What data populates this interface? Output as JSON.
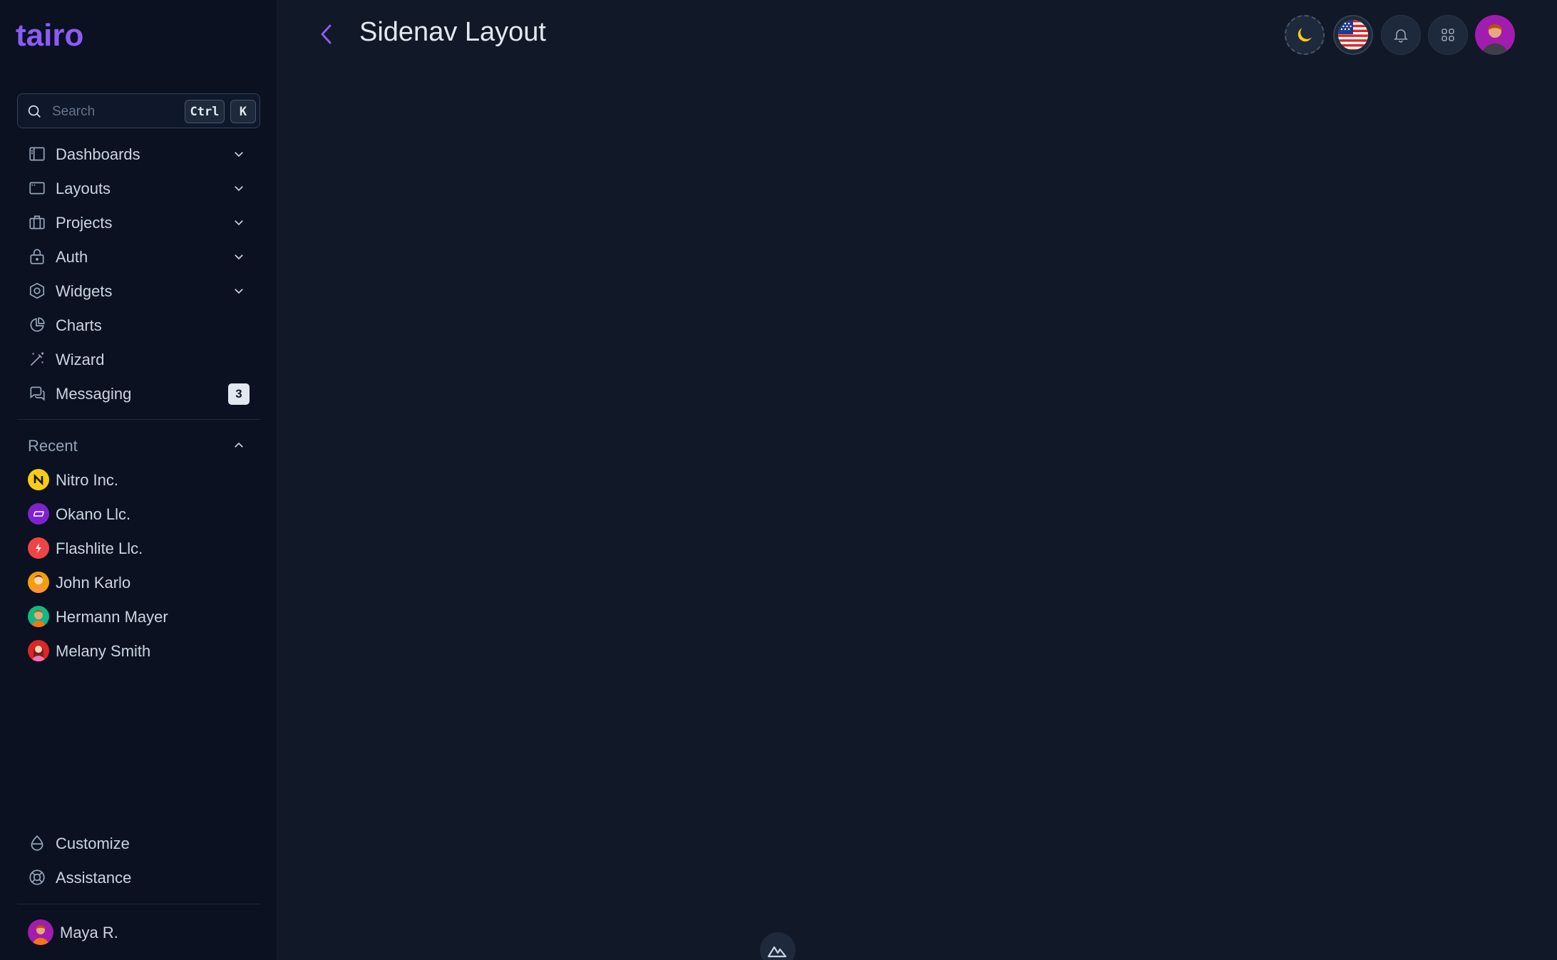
{
  "app": {
    "logo_text": "tairo"
  },
  "search": {
    "placeholder": "Search",
    "shortcut_ctrl": "Ctrl",
    "shortcut_key": "K"
  },
  "nav": {
    "items": [
      {
        "label": "Dashboards",
        "icon": "sidebar-layout-icon"
      },
      {
        "label": "Layouts",
        "icon": "window-icon"
      },
      {
        "label": "Projects",
        "icon": "briefcase-icon"
      },
      {
        "label": "Auth",
        "icon": "lock-icon"
      },
      {
        "label": "Widgets",
        "icon": "hexagon-icon"
      },
      {
        "label": "Charts",
        "icon": "pie-chart-icon"
      },
      {
        "label": "Wizard",
        "icon": "magic-wand-icon"
      },
      {
        "label": "Messaging",
        "icon": "chat-icon",
        "badge": "3"
      }
    ]
  },
  "recent": {
    "title": "Recent",
    "items": [
      {
        "label": "Nitro Inc.",
        "color": "#facc15"
      },
      {
        "label": "Okano Llc.",
        "color": "#7e22ce"
      },
      {
        "label": "Flashlite Llc.",
        "color": "#ef4444"
      },
      {
        "label": "John Karlo",
        "color": "#f59e0b"
      },
      {
        "label": "Hermann Mayer",
        "color": "#10b981"
      },
      {
        "label": "Melany Smith",
        "color": "#dc2626"
      }
    ]
  },
  "footer": {
    "customize": "Customize",
    "assistance": "Assistance",
    "user_name": "Maya R."
  },
  "header": {
    "title": "Sidenav Layout"
  },
  "colors": {
    "accent": "#8b5cf6",
    "background": "#111827",
    "sidebar": "#0b1120"
  }
}
